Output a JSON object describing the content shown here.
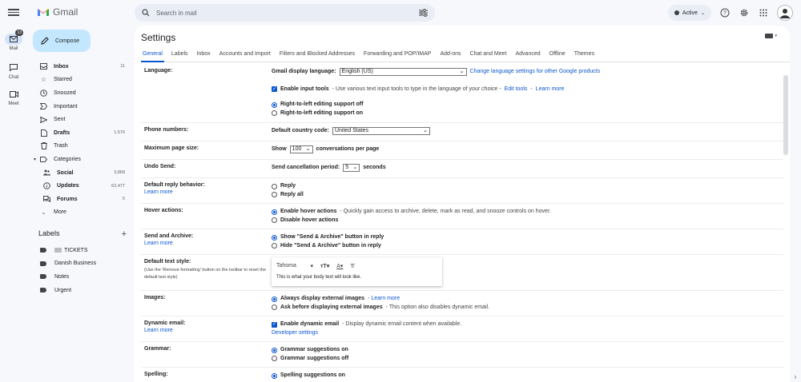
{
  "rail": {
    "mail_label": "Mail",
    "mail_badge": "13",
    "chat_label": "Chat",
    "meet_label": "Meet"
  },
  "app": {
    "name": "Gmail"
  },
  "search": {
    "placeholder": "Search in mail"
  },
  "status": {
    "label": "Active"
  },
  "compose_label": "Compose",
  "nav": [
    {
      "label": "Inbox",
      "count": "11",
      "bold": true
    },
    {
      "label": "Starred",
      "count": ""
    },
    {
      "label": "Snoozed",
      "count": ""
    },
    {
      "label": "Important",
      "count": ""
    },
    {
      "label": "Sent",
      "count": ""
    },
    {
      "label": "Drafts",
      "count": "1,576",
      "bold": true
    },
    {
      "label": "Trash",
      "count": ""
    },
    {
      "label": "Categories",
      "count": ""
    },
    {
      "label": "Social",
      "count": "3,868",
      "bold": true
    },
    {
      "label": "Updates",
      "count": "62,477",
      "bold": true
    },
    {
      "label": "Forums",
      "count": "5",
      "bold": true
    },
    {
      "label": "More",
      "count": ""
    }
  ],
  "labels": {
    "heading": "Labels",
    "items": [
      "TICKETS",
      "Danish Business",
      "Notes",
      "Urgent"
    ]
  },
  "settings": {
    "title": "Settings",
    "tabs": [
      "General",
      "Labels",
      "Inbox",
      "Accounts and Import",
      "Filters and Blocked Addresses",
      "Forwarding and POP/IMAP",
      "Add-ons",
      "Chat and Meet",
      "Advanced",
      "Offline",
      "Themes"
    ],
    "language": {
      "label": "Language:",
      "display_label": "Gmail display language:",
      "display_value": "English (US)",
      "change_link": "Change language settings for other Google products",
      "input_tools_bold": "Enable input tools",
      "input_tools_text": "- Use various text input tools to type in the language of your choice -",
      "edit_tools": "Edit tools",
      "learn_more": "Learn more",
      "rtl_off": "Right-to-left editing support off",
      "rtl_on": "Right-to-left editing support on"
    },
    "phone": {
      "label": "Phone numbers:",
      "country_label": "Default country code:",
      "country_value": "United States"
    },
    "page_size": {
      "label": "Maximum page size:",
      "show": "Show",
      "value": "100",
      "suffix": "conversations per page"
    },
    "undo": {
      "label": "Undo Send:",
      "period_label": "Send cancellation period:",
      "value": "5",
      "suffix": "seconds"
    },
    "reply": {
      "label": "Default reply behavior:",
      "learn_more": "Learn more",
      "opt1": "Reply",
      "opt2": "Reply all"
    },
    "hover": {
      "label": "Hover actions:",
      "opt1_bold": "Enable hover actions",
      "opt1_text": "- Quickly gain access to archive, delete, mark as read, and snooze controls on hover.",
      "opt2": "Disable hover actions"
    },
    "send_archive": {
      "label": "Send and Archive:",
      "learn_more": "Learn more",
      "opt1": "Show \"Send & Archive\" button in reply",
      "opt2": "Hide \"Send & Archive\" button in reply"
    },
    "text_style": {
      "label": "Default text style:",
      "note": "(Use the 'Remove formatting' button on the toolbar to reset the default text style)",
      "font": "Tahoma",
      "preview": "This is what your body text will look like."
    },
    "images": {
      "label": "Images:",
      "opt1_bold": "Always display external images",
      "opt1_link": "- Learn more",
      "opt2_bold": "Ask before displaying external images",
      "opt2_text": "- This option also disables dynamic email."
    },
    "dynamic": {
      "label": "Dynamic email:",
      "learn_more": "Learn more",
      "opt_bold": "Enable dynamic email",
      "opt_text": "- Display dynamic email content when available.",
      "dev_link": "Developer settings"
    },
    "grammar": {
      "label": "Grammar:",
      "opt1": "Grammar suggestions on",
      "opt2": "Grammar suggestions off"
    },
    "spelling": {
      "label": "Spelling:",
      "opt1": "Spelling suggestions on"
    }
  }
}
